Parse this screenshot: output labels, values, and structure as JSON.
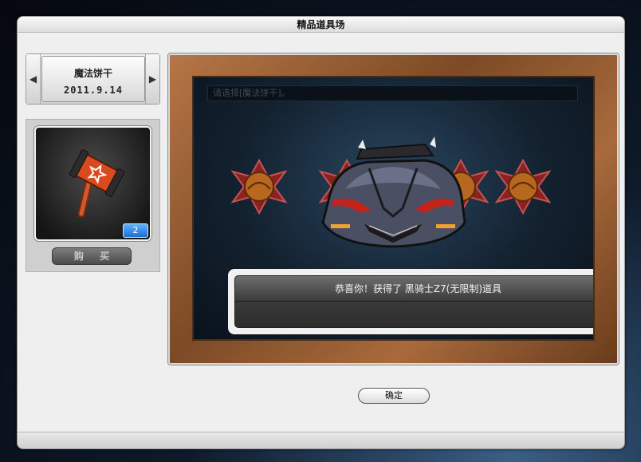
{
  "window": {
    "title": "精品道具场"
  },
  "date_selector": {
    "prev_icon": "triangle-left-icon",
    "next_icon": "triangle-right-icon",
    "name": "魔法饼干",
    "date": "2011.9.14"
  },
  "item": {
    "icon": "hammer-icon",
    "quantity": "2",
    "buy_label": "购 买"
  },
  "stage": {
    "prompt": "请选择[魔法饼干]。",
    "slot_icon": "fortune-cookie-icon",
    "prize_icon": "race-car-icon",
    "result_message": "恭喜你！获得了 黑骑士Z7(无限制)道具"
  },
  "footer": {
    "confirm_label": "确定"
  }
}
